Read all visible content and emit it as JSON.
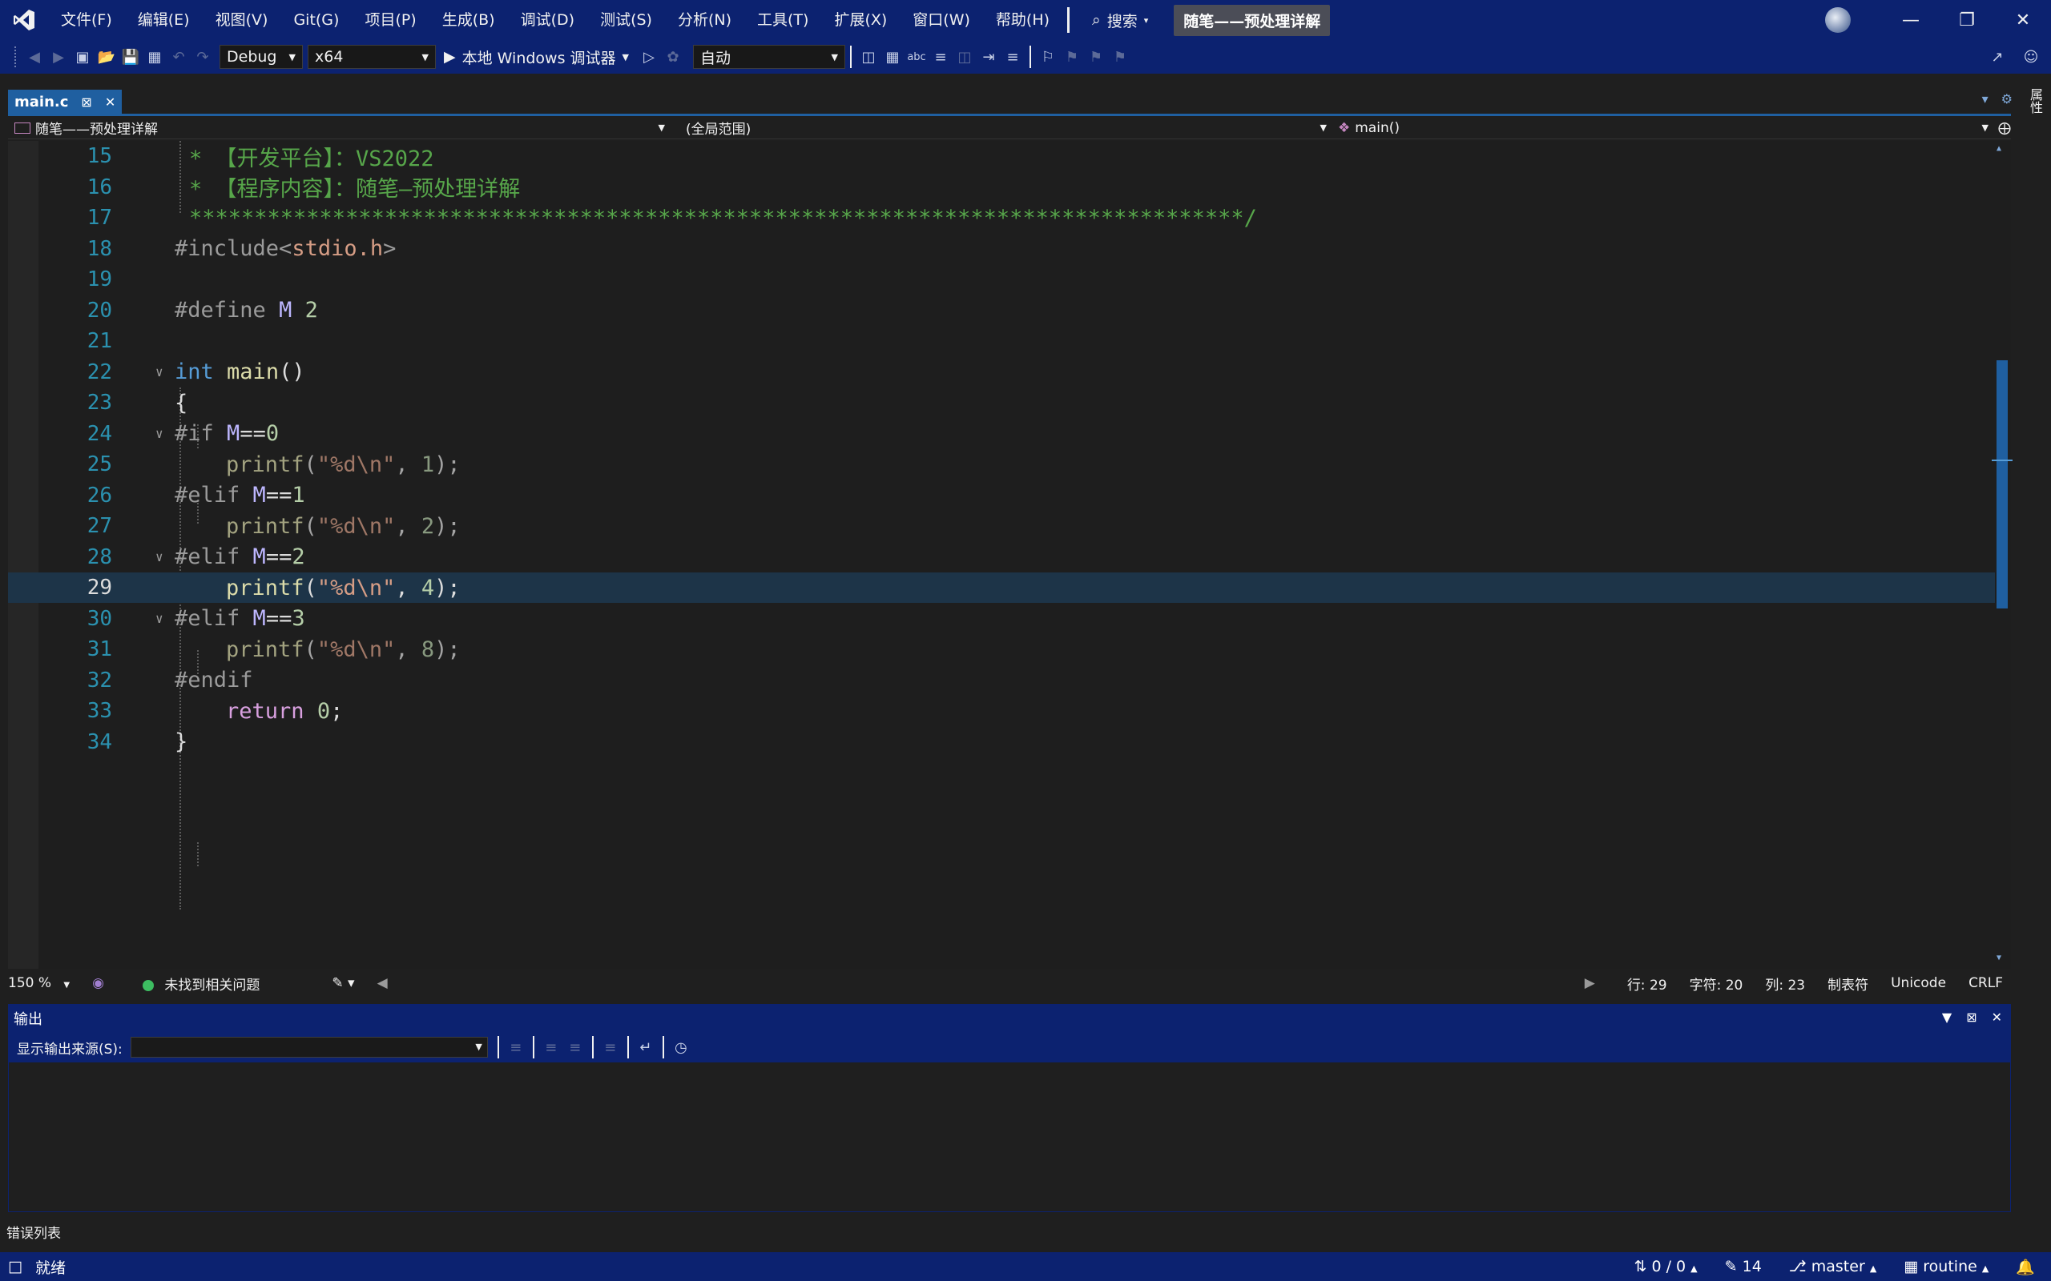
{
  "menu": [
    "文件(F)",
    "编辑(E)",
    "视图(V)",
    "Git(G)",
    "项目(P)",
    "生成(B)",
    "调试(D)",
    "测试(S)",
    "分析(N)",
    "工具(T)",
    "扩展(X)",
    "窗口(W)",
    "帮助(H)"
  ],
  "search_label": "搜索",
  "solution_title": "随笔——预处理详解",
  "toolbar": {
    "config": "Debug",
    "platform": "x64",
    "run_label": "本地 Windows 调试器",
    "auto": "自动"
  },
  "tab": {
    "name": "main.c"
  },
  "side_panel_label": "属性",
  "navbar": {
    "project": "随笔——预处理详解",
    "scope": "(全局范围)",
    "member": "main()"
  },
  "code": {
    "current_line": 29,
    "lines": [
      {
        "n": "15",
        "text": "* 【开发平台】：VS2022"
      },
      {
        "n": "16",
        "text": "* 【程序内容】：随笔—预处理详解"
      },
      {
        "n": "17",
        "text": "*********************************************************************************/"
      },
      {
        "n": "18",
        "text": "#include<stdio.h>"
      },
      {
        "n": "19",
        "text": ""
      },
      {
        "n": "20",
        "text": "#define M 2"
      },
      {
        "n": "21",
        "text": ""
      },
      {
        "n": "22",
        "text": "int main()"
      },
      {
        "n": "23",
        "text": "{"
      },
      {
        "n": "24",
        "text": "#if M==0"
      },
      {
        "n": "25",
        "text": "printf(\"%d\\n\", 1);"
      },
      {
        "n": "26",
        "text": "#elif M==1"
      },
      {
        "n": "27",
        "text": "printf(\"%d\\n\", 2);"
      },
      {
        "n": "28",
        "text": "#elif M==2"
      },
      {
        "n": "29",
        "text": "printf(\"%d\\n\", 4);"
      },
      {
        "n": "30",
        "text": "#elif M==3"
      },
      {
        "n": "31",
        "text": "printf(\"%d\\n\", 8);"
      },
      {
        "n": "32",
        "text": "#endif"
      },
      {
        "n": "33",
        "text": "return 0;"
      },
      {
        "n": "34",
        "text": "}"
      }
    ]
  },
  "editor_status": {
    "zoom": "150 %",
    "issues": "未找到相关问题",
    "line": "行: 29",
    "char": "字符: 20",
    "col": "列: 23",
    "tabs": "制表符",
    "encoding": "Unicode",
    "eol": "CRLF"
  },
  "output": {
    "title": "输出",
    "source_label": "显示输出来源(S):"
  },
  "error_list_tab": "错误列表",
  "status": {
    "ready": "就绪",
    "sync": "0 / 0",
    "changes": "14",
    "branch": "master",
    "repo": "routine"
  },
  "colors": {
    "accent": "#0c2270",
    "tab": "#1f5fa0",
    "current_line": "#1d3448",
    "line_number": "#2b91af",
    "comment": "#57a64a",
    "string": "#d69d85",
    "keyword": "#569cd6",
    "macro": "#beb7ff"
  }
}
